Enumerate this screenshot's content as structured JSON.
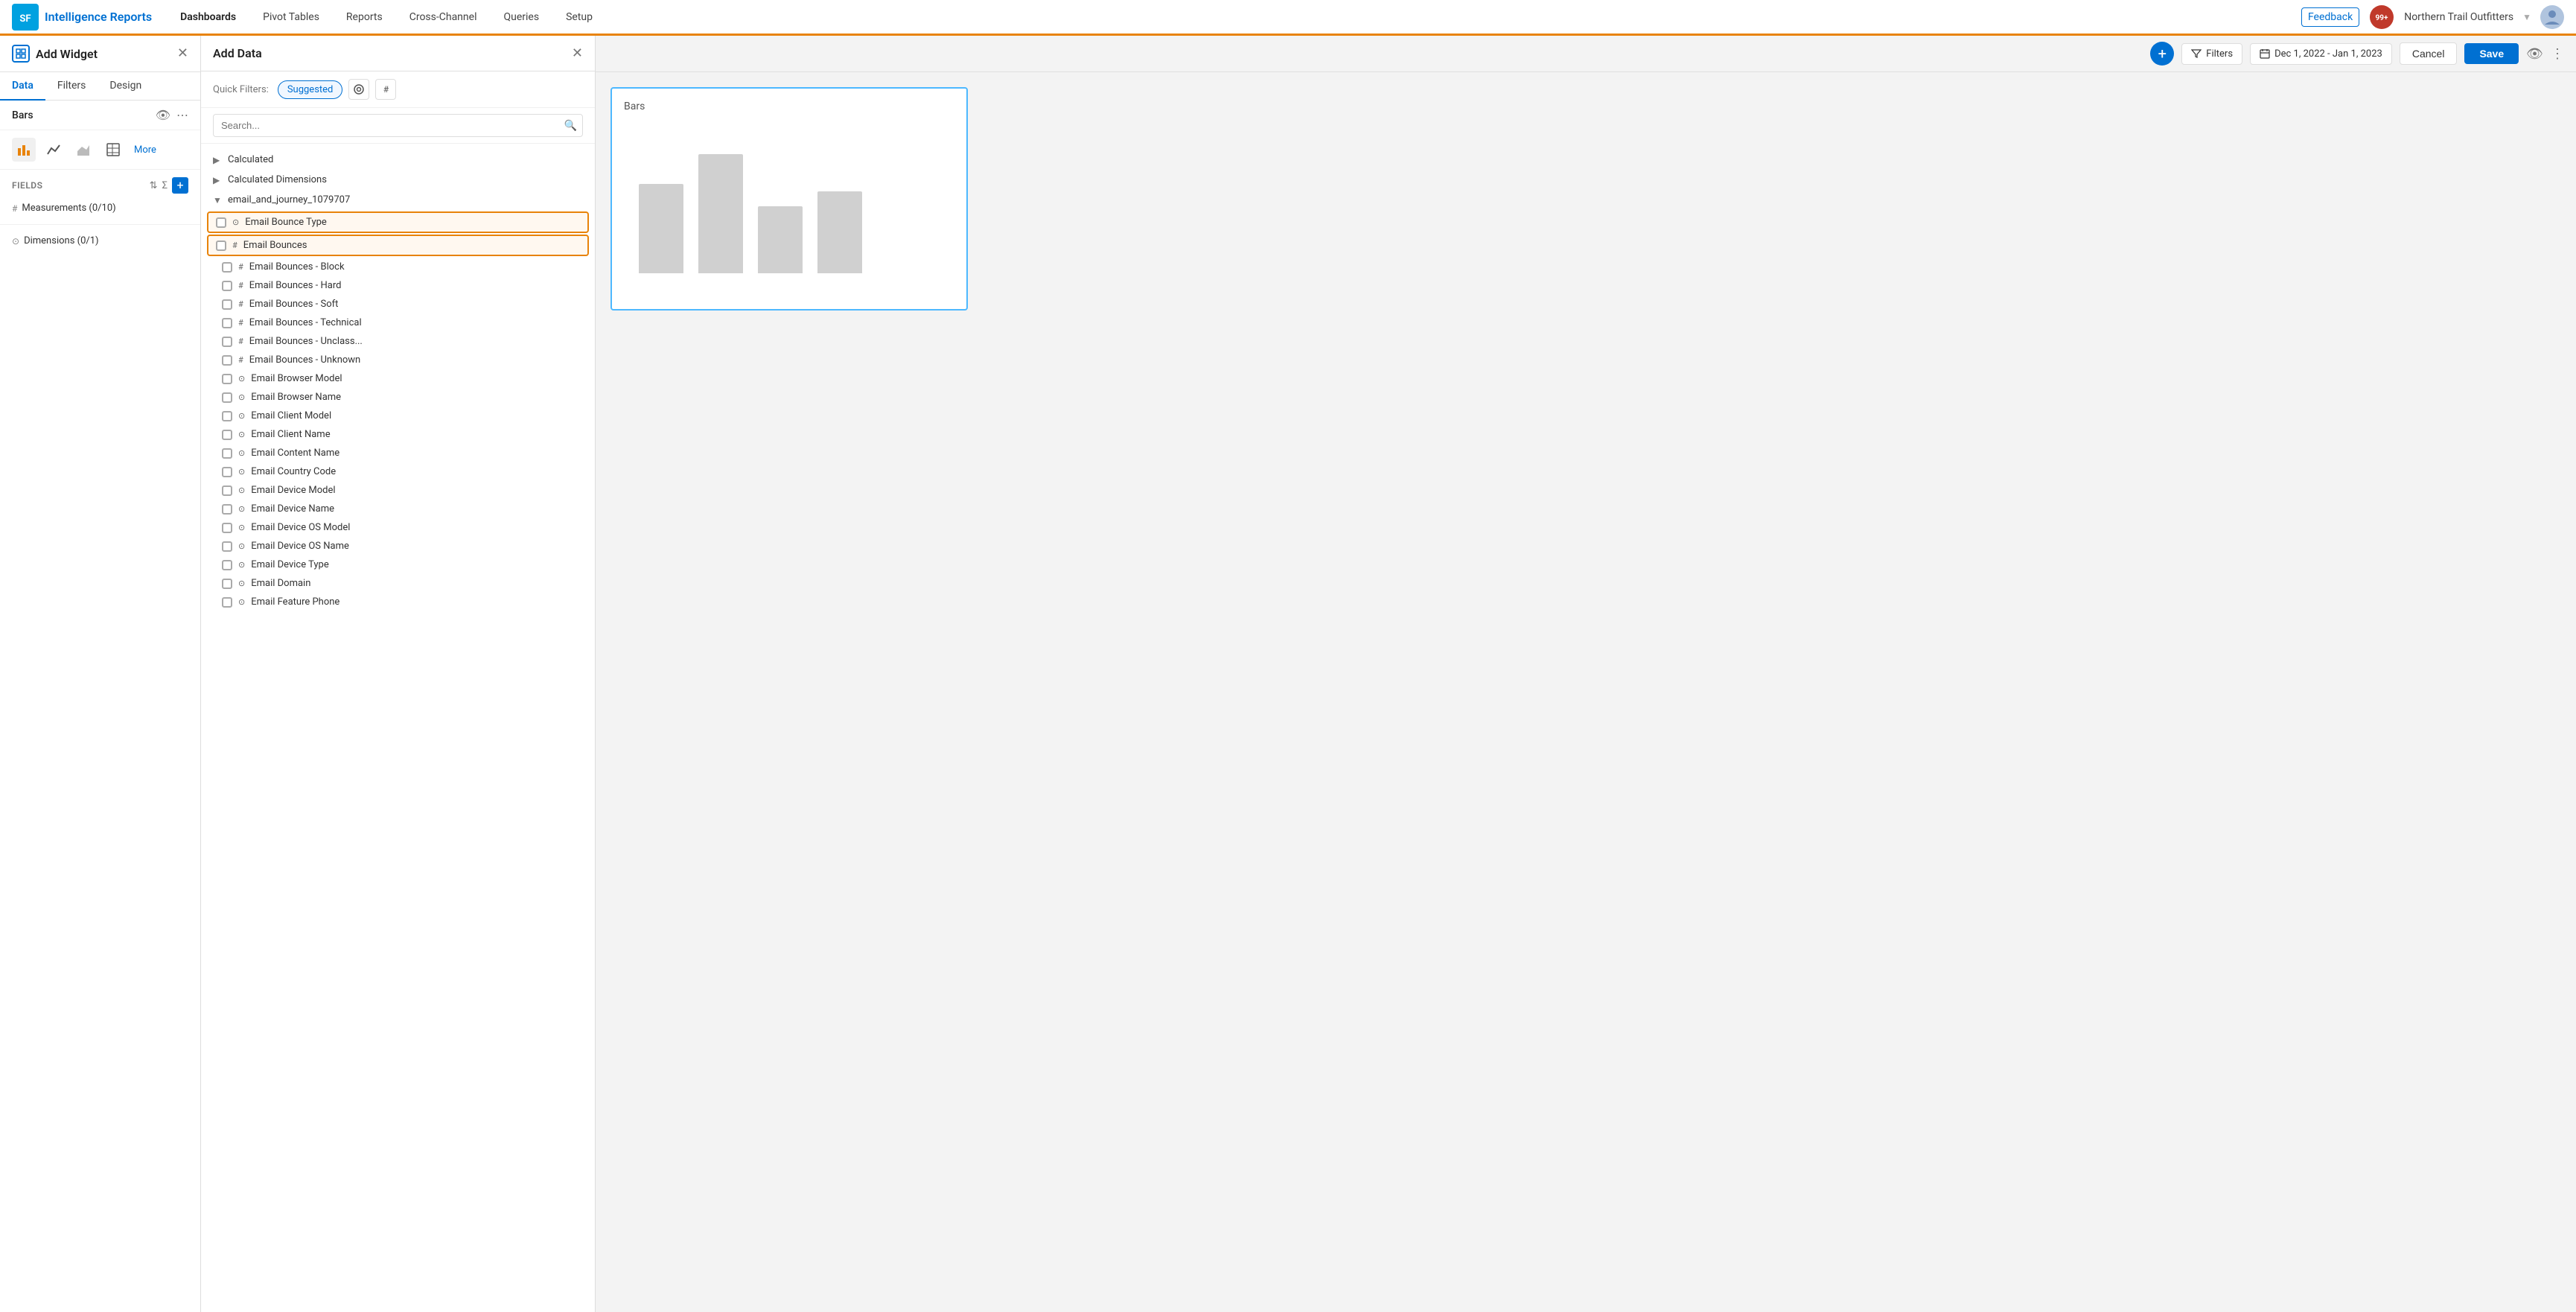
{
  "app": {
    "brand": "Intelligence Reports",
    "logo_text": "SF"
  },
  "nav": {
    "tabs": [
      {
        "label": "Dashboards",
        "active": true
      },
      {
        "label": "Pivot Tables",
        "active": false
      },
      {
        "label": "Reports",
        "active": false
      },
      {
        "label": "Cross-Channel",
        "active": false
      },
      {
        "label": "Queries",
        "active": false
      },
      {
        "label": "Setup",
        "active": false
      }
    ],
    "feedback": "Feedback",
    "badge": "99+",
    "org_name": "Northern Trail Outfitters"
  },
  "add_widget": {
    "title": "Add Widget",
    "tabs": [
      "Data",
      "Filters",
      "Design"
    ],
    "active_tab": "Data",
    "widget_name": "Bars",
    "fields_label": "FIELDS",
    "measurements": "Measurements (0/10)",
    "dimensions": "Dimensions (0/1)"
  },
  "add_data": {
    "title": "Add Data",
    "quick_filters_label": "Quick Filters:",
    "quick_filters": [
      "Suggested"
    ],
    "search_placeholder": "Search...",
    "tree": [
      {
        "label": "Calculated",
        "expanded": false,
        "type": "collapse"
      },
      {
        "label": "Calculated Dimensions",
        "expanded": false,
        "type": "collapse"
      },
      {
        "label": "email_and_journey_1079707",
        "expanded": true,
        "type": "expand",
        "children": [
          {
            "label": "Email Bounce Type",
            "type": "dimension",
            "checked": false,
            "highlighted": true
          },
          {
            "label": "Email Bounces",
            "type": "measure",
            "checked": false,
            "highlighted": true
          },
          {
            "label": "Email Bounces - Block",
            "type": "measure",
            "checked": false,
            "highlighted": false
          },
          {
            "label": "Email Bounces - Hard",
            "type": "measure",
            "checked": false,
            "highlighted": false
          },
          {
            "label": "Email Bounces - Soft",
            "type": "measure",
            "checked": false,
            "highlighted": false
          },
          {
            "label": "Email Bounces - Technical",
            "type": "measure",
            "checked": false,
            "highlighted": false
          },
          {
            "label": "Email Bounces - Unclass...",
            "type": "measure",
            "checked": false,
            "highlighted": false
          },
          {
            "label": "Email Bounces - Unknown",
            "type": "measure",
            "checked": false,
            "highlighted": false
          },
          {
            "label": "Email Browser Model",
            "type": "dimension",
            "checked": false,
            "highlighted": false
          },
          {
            "label": "Email Browser Name",
            "type": "dimension",
            "checked": false,
            "highlighted": false
          },
          {
            "label": "Email Client Model",
            "type": "dimension",
            "checked": false,
            "highlighted": false
          },
          {
            "label": "Email Client Name",
            "type": "dimension",
            "checked": false,
            "highlighted": false
          },
          {
            "label": "Email Content Name",
            "type": "dimension",
            "checked": false,
            "highlighted": false
          },
          {
            "label": "Email Country Code",
            "type": "dimension",
            "checked": false,
            "highlighted": false
          },
          {
            "label": "Email Device Model",
            "type": "dimension",
            "checked": false,
            "highlighted": false
          },
          {
            "label": "Email Device Name",
            "type": "dimension",
            "checked": false,
            "highlighted": false
          },
          {
            "label": "Email Device OS Model",
            "type": "dimension",
            "checked": false,
            "highlighted": false
          },
          {
            "label": "Email Device OS Name",
            "type": "dimension",
            "checked": false,
            "highlighted": false
          },
          {
            "label": "Email Device Type",
            "type": "dimension",
            "checked": false,
            "highlighted": false
          },
          {
            "label": "Email Domain",
            "type": "dimension",
            "checked": false,
            "highlighted": false
          },
          {
            "label": "Email Feature Phone",
            "type": "dimension",
            "checked": false,
            "highlighted": false
          }
        ]
      }
    ]
  },
  "toolbar": {
    "filters_label": "Filters",
    "date_range": "Dec 1, 2022 - Jan 1, 2023",
    "cancel_label": "Cancel",
    "save_label": "Save"
  },
  "chart_preview": {
    "title": "Bars",
    "bars": [
      {
        "height": 120
      },
      {
        "height": 160
      },
      {
        "height": 90
      },
      {
        "height": 110
      }
    ]
  }
}
